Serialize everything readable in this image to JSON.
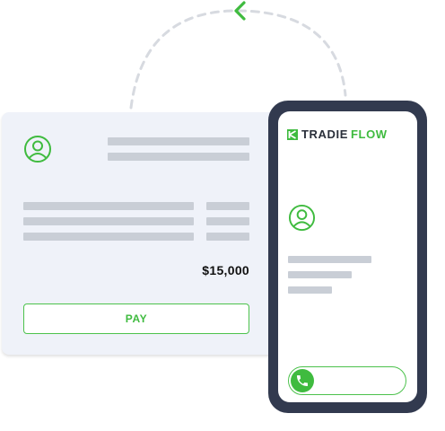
{
  "invoice": {
    "total": "$15,000",
    "pay_label": "PAY"
  },
  "phone": {
    "brand_part1": "TRADIE",
    "brand_part2": "FLOW"
  },
  "icons": {
    "loop_arrow": "chevron-left-icon",
    "invoice_avatar": "user-icon",
    "phone_avatar": "user-icon",
    "call": "phone-icon"
  },
  "colors": {
    "accent": "#3fbb3f",
    "phone_frame": "#323a4f",
    "invoice_bg": "#eff2f9",
    "placeholder_bar": "#c9ced6"
  }
}
